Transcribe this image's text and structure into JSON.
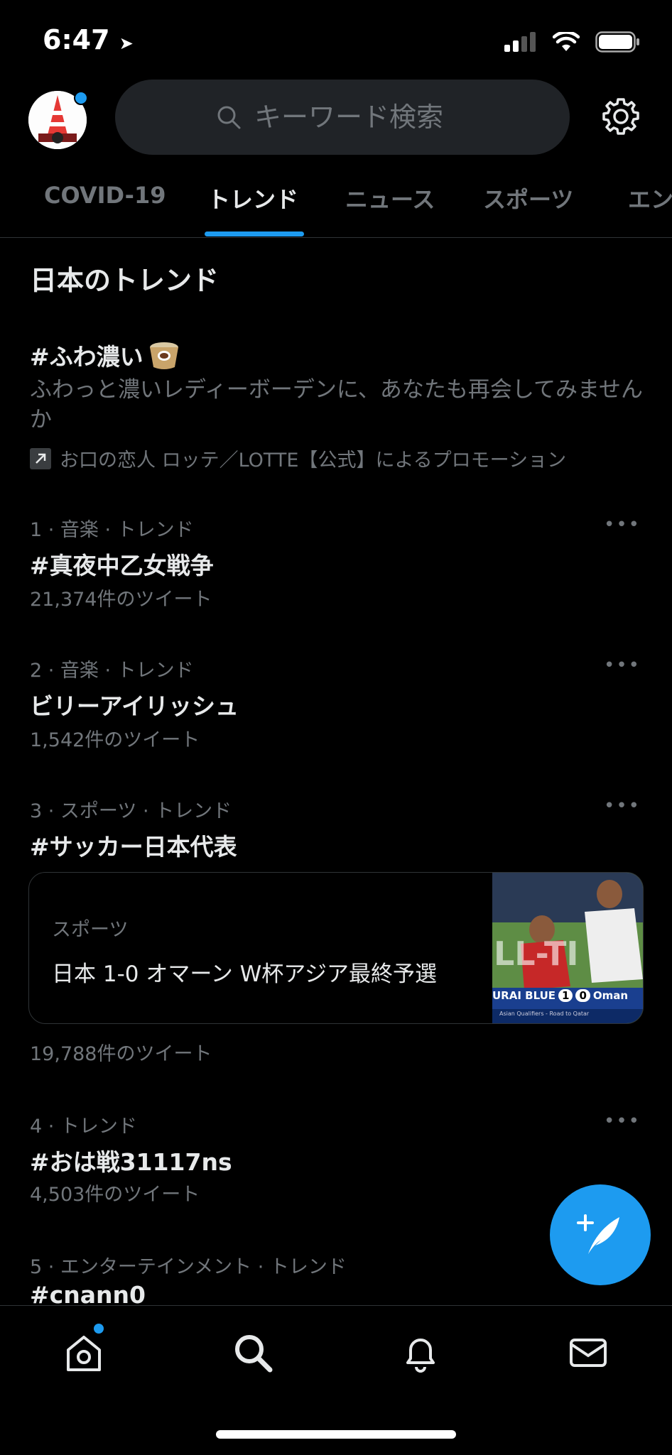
{
  "status_bar": {
    "time": "6:47"
  },
  "search": {
    "placeholder": "キーワード検索"
  },
  "tabs": [
    {
      "label": "COVID-19"
    },
    {
      "label": "トレンド"
    },
    {
      "label": "ニュース"
    },
    {
      "label": "スポーツ"
    },
    {
      "label": "エン"
    }
  ],
  "section_title": "日本のトレンド",
  "promo": {
    "title": "#ふわ濃い",
    "description": "ふわっと濃いレディーボーデンに、あなたも再会してみませんか",
    "promoted_by": "お口の恋人 ロッテ／LOTTE【公式】によるプロモーション"
  },
  "trends": [
    {
      "meta": "1 · 音楽 · トレンド",
      "name": "#真夜中乙女戦争",
      "count": "21,374件のツイート"
    },
    {
      "meta": "2 · 音楽 · トレンド",
      "name": "ビリーアイリッシュ",
      "count": "1,542件のツイート"
    },
    {
      "meta": "3 · スポーツ · トレンド",
      "name": "#サッカー日本代表",
      "count": "19,788件のツイート",
      "card": {
        "category": "スポーツ",
        "headline": "日本 1-0 オマーン W杯アジア最終予選",
        "image_banner": "URAI BLUE",
        "image_score_home": "1",
        "image_score_away": "0",
        "image_team": "Oman",
        "image_sub": "Asian Qualifiers - Road to Qatar"
      }
    },
    {
      "meta": "4 · トレンド",
      "name": "#おは戦31117ns",
      "count": "4,503件のツイート"
    },
    {
      "meta": "5 · エンターテインメント · トレンド",
      "name": "#cnann0",
      "count": ""
    }
  ],
  "more_label": "•••",
  "colors": {
    "accent": "#1d9bf0",
    "background": "#000000",
    "muted": "#71767b"
  },
  "icons": {
    "search": "search-icon",
    "settings": "gear-icon",
    "home": "home-icon",
    "explore": "search-icon",
    "notifications": "bell-icon",
    "messages": "mail-icon",
    "compose": "compose-tweet-icon"
  }
}
